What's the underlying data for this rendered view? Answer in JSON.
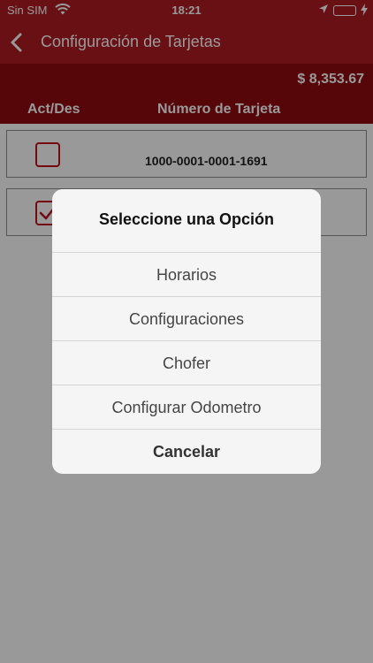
{
  "status_bar": {
    "carrier": "Sin SIM",
    "time": "18:21",
    "icons": [
      "wifi-icon",
      "location-arrow-icon",
      "battery-icon",
      "charging-icon"
    ]
  },
  "nav": {
    "title": "Configuración de Tarjetas",
    "back_icon": "chevron-left-icon"
  },
  "header": {
    "balance": "$ 8,353.67",
    "col_act": "Act/Des",
    "col_number": "Número de Tarjeta"
  },
  "cards": [
    {
      "number": "1000-0001-0001-1691",
      "checked": false
    },
    {
      "number": "",
      "checked": true
    }
  ],
  "action_sheet": {
    "title": "Seleccione una Opción",
    "options": [
      "Horarios",
      "Configuraciones",
      "Chofer",
      "Configurar Odometro"
    ],
    "cancel": "Cancelar"
  },
  "colors": {
    "primary_red": "#b01c22",
    "dark_red": "#8f0a10",
    "check_red": "#c1121c",
    "battery_green": "#4cd964"
  }
}
